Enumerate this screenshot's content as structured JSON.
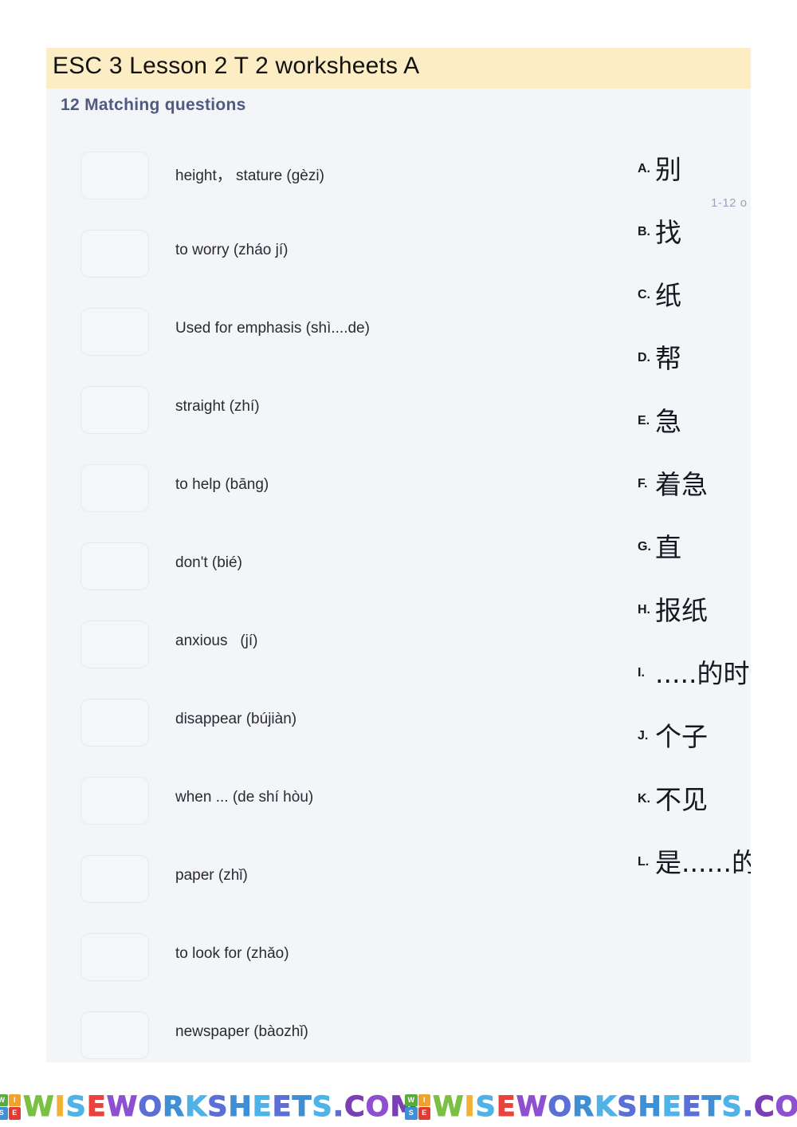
{
  "worksheet": {
    "title": "ESC 3 Lesson 2 T 2 worksheets A",
    "section_heading": "12 Matching questions",
    "pager_label": "1-12 o",
    "title_band_color": "#fcedc4",
    "card_background": "#f4f5f9",
    "heading_color": "#4e5a80"
  },
  "prompts": [
    {
      "text": "height， stature (gèzi)"
    },
    {
      "text": "to worry (zháo jí)"
    },
    {
      "text": "Used for emphasis (shì....de)"
    },
    {
      "text": "straight (zhí)"
    },
    {
      "text": "to help (bāng)"
    },
    {
      "text": "don't (bié)"
    },
    {
      "text": "anxious   (jí)"
    },
    {
      "text": "disappear (bújiàn)"
    },
    {
      "text": "when ... (de shí hòu)"
    },
    {
      "text": "paper (zhǐ)"
    },
    {
      "text": "to look for (zhǎo)"
    },
    {
      "text": "newspaper (bàozhǐ)"
    }
  ],
  "options": [
    {
      "letter": "A.",
      "text": "别"
    },
    {
      "letter": "B.",
      "text": "找"
    },
    {
      "letter": "C.",
      "text": "纸"
    },
    {
      "letter": "D.",
      "text": "帮"
    },
    {
      "letter": "E.",
      "text": "急"
    },
    {
      "letter": "F.",
      "text": "着急"
    },
    {
      "letter": "G.",
      "text": "直"
    },
    {
      "letter": "H.",
      "text": "报纸"
    },
    {
      "letter": "I.",
      "text": ".....的时候"
    },
    {
      "letter": "J.",
      "text": "个子"
    },
    {
      "letter": "K.",
      "text": "不见"
    },
    {
      "letter": "L.",
      "text": "是......的"
    }
  ],
  "watermark": {
    "text": "WISEWORKSHEETS.COM",
    "tile_letters": [
      "W",
      "I",
      "S",
      "E"
    ],
    "tile_colors": [
      "#5aab3e",
      "#f0a32a",
      "#3f8fd4",
      "#e23b33"
    ],
    "letter_colors": [
      "#7ac143",
      "#f2b134",
      "#4fb3e8",
      "#e8433c",
      "#8e4fd0",
      "#5b6fd6",
      "#3f8fd4",
      "#4fb3e8",
      "#5b6fd6",
      "#3f8fd4",
      "#4fb3e8",
      "#5b6fd6",
      "#3f8fd4",
      "#4fb3e8",
      "#5b6fd6",
      "#7b3fb5",
      "#8e4fd0",
      "#7b3fb5"
    ]
  }
}
